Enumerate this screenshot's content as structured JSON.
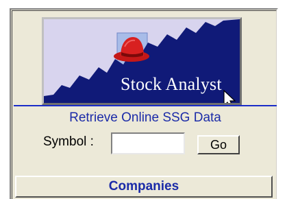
{
  "logo": {
    "text": "Stock Analyst",
    "icon": "red-hat-icon",
    "colors": {
      "background": "#d8d4ee",
      "chart_fill": "#101a78",
      "hat": "#d41c1c",
      "text": "#ffffff"
    }
  },
  "retrieve_label": "Retrieve Online SSG Data",
  "symbol": {
    "label": "Symbol :",
    "value": ""
  },
  "go_label": "Go",
  "companies_label": "Companies",
  "cursor_icon": "mouse-pointer-icon",
  "accent_color": "#1b2ba8"
}
